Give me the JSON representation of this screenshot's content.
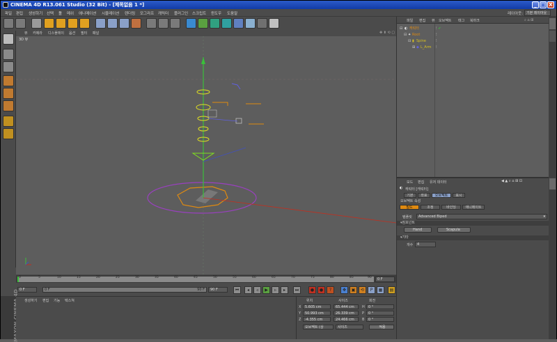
{
  "window": {
    "title": "CINEMA 4D R13.061 Studio (32 Bit) - [제목없음 1 *]",
    "controls": [
      "_",
      "□",
      "X"
    ]
  },
  "menubar": {
    "items": [
      "파일",
      "편집",
      "생성하기",
      "선택",
      "툴",
      "메쉬",
      "애니메이션",
      "시뮬레이션",
      "렌더링",
      "모그라프",
      "캐릭터",
      "플러그인",
      "스크립트",
      "윈도우",
      "도움말"
    ],
    "layout_label": "레이아웃:",
    "layout_value": "기본 레이아웃"
  },
  "viewport": {
    "menu": [
      "뷰",
      "카메라",
      "디스플레이",
      "옵션",
      "필터",
      "패널"
    ],
    "label": "3D 뷰"
  },
  "timeline": {
    "ticks": [
      "0",
      "5",
      "10",
      "15",
      "20",
      "25",
      "30",
      "35",
      "40",
      "45",
      "50",
      "55",
      "60",
      "65",
      "70",
      "75",
      "80",
      "85",
      "90"
    ],
    "current_frame": "0 F"
  },
  "transport": {
    "start": "0 F",
    "slider_value": "0 F",
    "end_slider": "90 F",
    "end": "90 F"
  },
  "material_manager": {
    "menu": [
      "생성하기",
      "편집",
      "기능",
      "텍스쳐"
    ]
  },
  "maxon": {
    "text": "MAXON CINEMA 4D"
  },
  "coordinates": {
    "headers": [
      "위치",
      "사이즈",
      "회전"
    ],
    "rows": [
      {
        "axis": "X",
        "pos": "5.605 cm",
        "size": "65.444 cm",
        "rot_axis": "H",
        "rot": "0 °"
      },
      {
        "axis": "Y",
        "pos": "50.993 cm",
        "size": "26.339 cm",
        "rot_axis": "P",
        "rot": "0 °"
      },
      {
        "axis": "Z",
        "pos": "-4.355 cm",
        "size": "24.466 cm",
        "rot_axis": "B",
        "rot": "0 °"
      }
    ],
    "mode_select": "오브젝트 (상",
    "size_select": "사이즈",
    "apply": "적용"
  },
  "object_manager": {
    "menu": [
      "파일",
      "편집",
      "뷰",
      "오브젝트",
      "태그",
      "북마크"
    ],
    "objects": [
      {
        "name": "캐릭터",
        "color": "#e08a10"
      },
      {
        "name": "Root",
        "color": "#e08a10"
      },
      {
        "name": "Spine",
        "color": "#d8c020"
      },
      {
        "name": "L_Arm",
        "color": "#d8c020"
      }
    ]
  },
  "attribute_manager": {
    "menu": [
      "모드",
      "편집",
      "유저 데이터"
    ],
    "object_title": "캐릭터 [캐릭터]",
    "tabs_row1": [
      "기본",
      "좌표",
      "오브젝트",
      "표시"
    ],
    "section_title": "오브젝트 속성",
    "tabs_row2": [
      "빌드",
      "조정",
      "바인딩",
      "애니메이트"
    ],
    "template_label": "템플릿",
    "template_value": "Advanced Biped",
    "components_label": "▾컴포넌트",
    "buttons": [
      "Hand",
      "Scapula"
    ],
    "other_label": "▾기타",
    "count_label": "개수",
    "count_value": "4"
  }
}
